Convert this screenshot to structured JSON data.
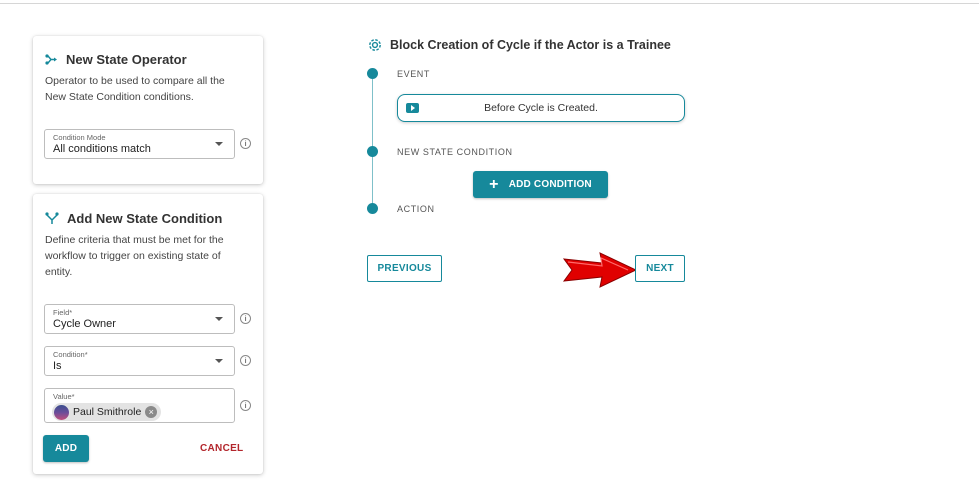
{
  "operator_card": {
    "title": "New State Operator",
    "icon": "operator-icon",
    "description_line1": "Operator to be used to compare all the",
    "description_line2": "New State Condition conditions.",
    "mode_field": {
      "label": "Condition Mode",
      "value": "All conditions match"
    }
  },
  "condition_card": {
    "title": "Add New State Condition",
    "icon": "branch-icon",
    "description_line1": "Define criteria that must be met for the",
    "description_line2": "workflow to trigger on existing state of",
    "description_line3": "entity.",
    "field": {
      "label": "Field*",
      "value": "Cycle Owner"
    },
    "condition": {
      "label": "Condition*",
      "value": "Is"
    },
    "value_field": {
      "label": "Value*",
      "chip": "Paul Smithrole"
    },
    "add_label": "ADD",
    "cancel_label": "CANCEL"
  },
  "info_icon_glyph": "i",
  "workflow": {
    "title": "Block Creation of Cycle if the Actor is a Trainee",
    "icon": "gear-icon",
    "steps": {
      "event": "EVENT",
      "new_state_condition": "NEW STATE CONDITION",
      "action": "ACTION"
    },
    "event_value": "Before Cycle is Created.",
    "add_condition_label": "ADD CONDITION",
    "add_condition_icon": "plus-icon"
  },
  "nav": {
    "previous_label": "PREVIOUS",
    "next_label": "NEXT"
  },
  "colors": {
    "accent": "#16899b",
    "cancel": "#b3262c",
    "pointer_arrow": "#e00000"
  }
}
